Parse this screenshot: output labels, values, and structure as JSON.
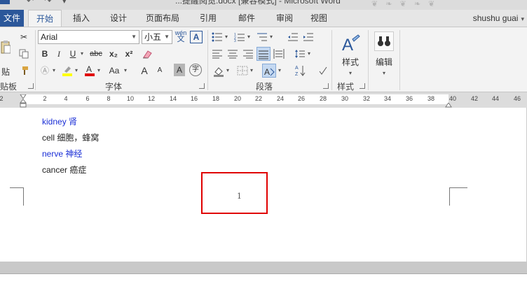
{
  "titlebar": {
    "title": "...提醒阅览.docx [兼容模式] - Microsoft Word"
  },
  "tabs": [
    {
      "label": "文件"
    },
    {
      "label": "开始"
    },
    {
      "label": "插入"
    },
    {
      "label": "设计"
    },
    {
      "label": "页面布局"
    },
    {
      "label": "引用"
    },
    {
      "label": "邮件"
    },
    {
      "label": "审阅"
    },
    {
      "label": "视图"
    }
  ],
  "user": {
    "name": "shushu guai"
  },
  "ribbon": {
    "clipboard": {
      "paste_label": "贴",
      "group_label": "贴板"
    },
    "font": {
      "font_name": "Arial",
      "font_size": "小五",
      "phonetic": "wén",
      "phonetic_char": "文",
      "bold": "B",
      "italic": "I",
      "underline": "U",
      "strike": "abc",
      "subscript": "x₂",
      "superscript": "x²",
      "change_case": "Aa",
      "grow": "A",
      "shrink": "A",
      "char_shading": "A",
      "enclose": "字",
      "group_label": "字体"
    },
    "paragraph": {
      "group_label": "段落"
    },
    "styles": {
      "label": "样式",
      "group_label": "样式"
    },
    "editing": {
      "label": "编辑"
    }
  },
  "ruler": {
    "ticks": [
      "2",
      "2",
      "4",
      "6",
      "8",
      "10",
      "12",
      "14",
      "16",
      "18",
      "20",
      "22",
      "24",
      "26",
      "28",
      "30",
      "32",
      "34",
      "36",
      "38",
      "40",
      "42",
      "44",
      "46"
    ]
  },
  "document": {
    "lines": [
      {
        "text": "kidney  肾",
        "color": "#1a2ed6"
      },
      {
        "text": "cell  细胞，蜂窝",
        "color": "#222222"
      },
      {
        "text": "nerve  神经",
        "color": "#1a2ed6"
      },
      {
        "text": "cancer  癌症",
        "color": "#222222"
      }
    ],
    "page_number": "1",
    "highlight_color": "#e00000"
  }
}
